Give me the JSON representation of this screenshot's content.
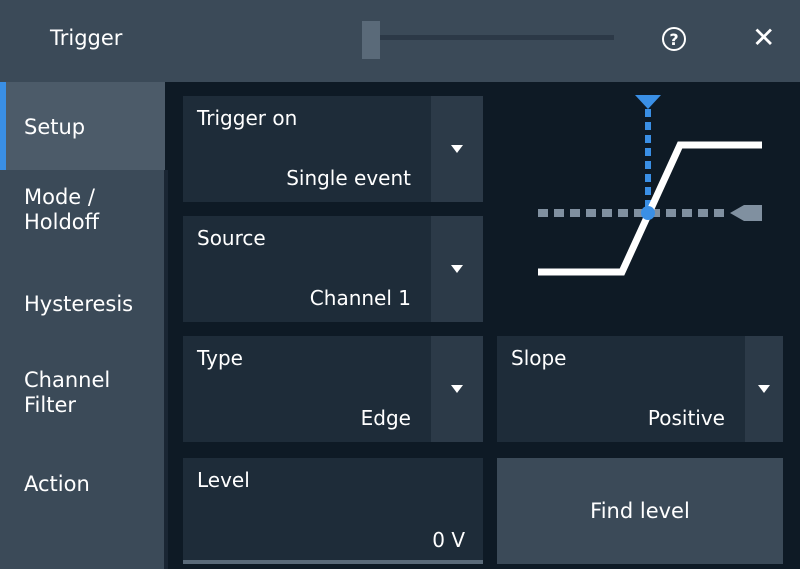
{
  "window": {
    "title": "Trigger",
    "help_symbol": "?",
    "close_symbol": "✕"
  },
  "sidebar": {
    "items": [
      {
        "label": "Setup"
      },
      {
        "label": "Mode /\nHoldoff"
      },
      {
        "label": "Hysteresis"
      },
      {
        "label": "Channel\nFilter"
      },
      {
        "label": "Action"
      }
    ]
  },
  "fields": {
    "trigger_on": {
      "label": "Trigger on",
      "value": "Single event"
    },
    "source": {
      "label": "Source",
      "value": "Channel 1"
    },
    "type": {
      "label": "Type",
      "value": "Edge"
    },
    "slope": {
      "label": "Slope",
      "value": "Positive"
    },
    "level": {
      "label": "Level",
      "value": "0 V"
    }
  },
  "buttons": {
    "find_level": "Find level"
  },
  "colors": {
    "accent": "#3a8fe5",
    "panel": "#3b4a58",
    "field_bg": "#1e2c39",
    "dark_bg": "#0e1a25"
  },
  "icons": {
    "help": "help-circle-icon",
    "close": "close-icon",
    "dropdown": "chevron-down-icon",
    "diagram": "edge-trigger-diagram-icon"
  }
}
